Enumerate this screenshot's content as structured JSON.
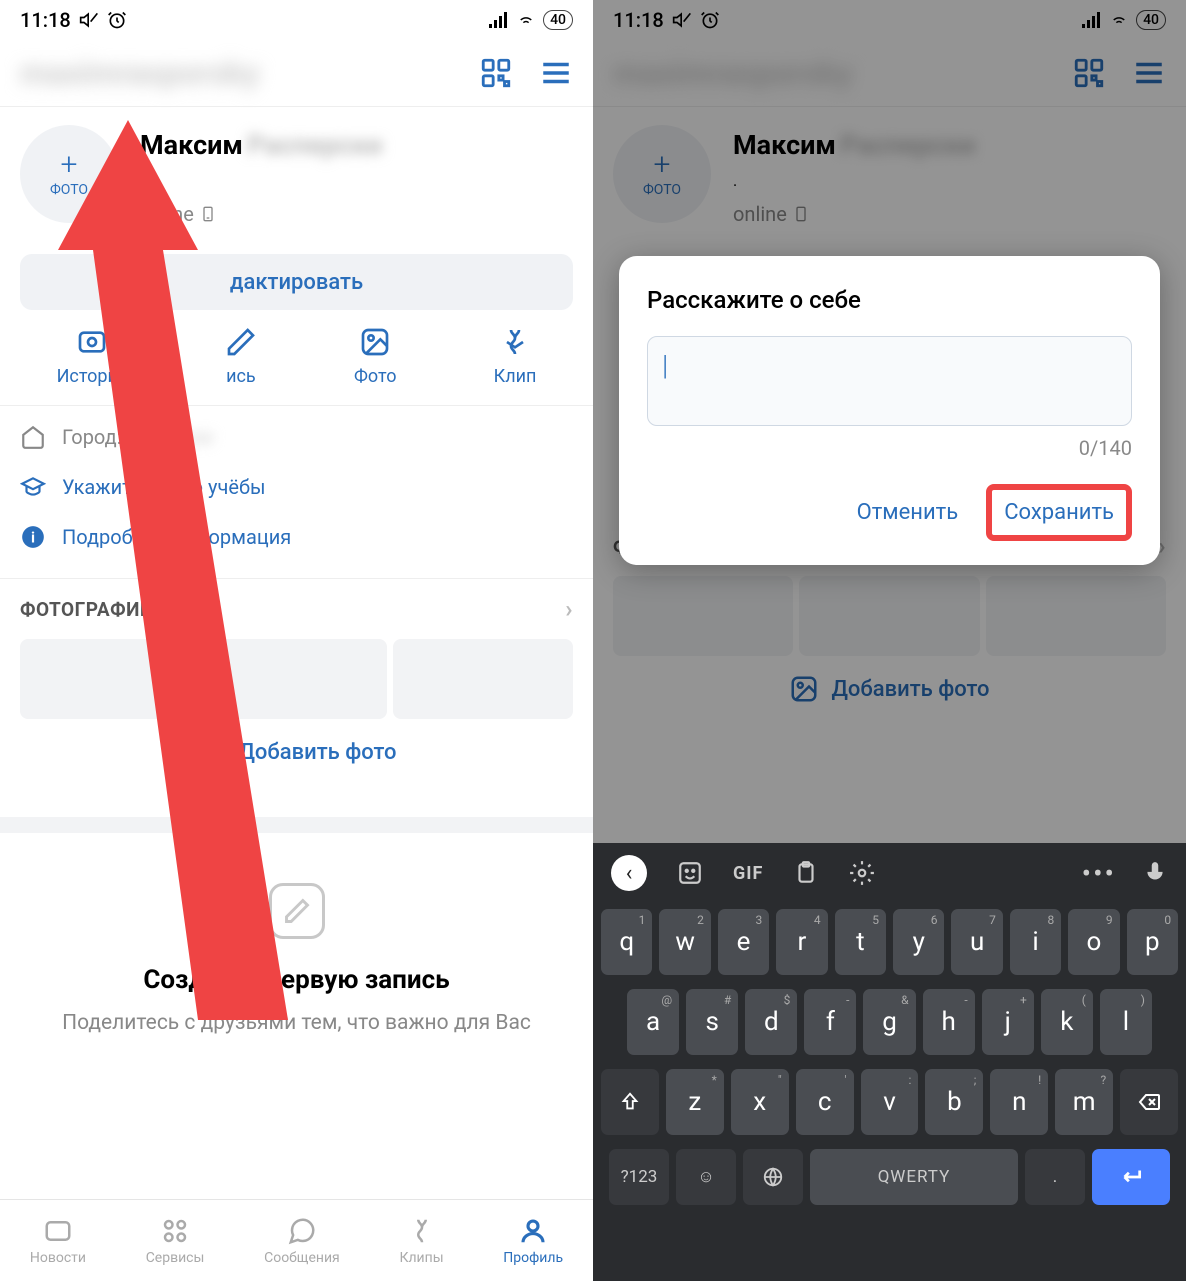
{
  "status": {
    "time": "11:18",
    "battery": "40"
  },
  "header": {
    "username_blur": "maximrasporsky"
  },
  "profile": {
    "photo_label": "ФОТО",
    "name_first": "Максим",
    "name_blur": "Расперски",
    "status_dot": ".",
    "online": "online"
  },
  "edit_button": "дактировать",
  "actions": {
    "story": "История",
    "post": "ись",
    "photo": "Фото",
    "clip": "Клип"
  },
  "info": {
    "city_label": "Город:",
    "study": "Укажите место учёбы",
    "details": "Подробная информация"
  },
  "photos_section": "ФОТОГРАФИИ",
  "add_photo": "Добавить фото",
  "add_photo_right": "Добавить фото",
  "create_post": {
    "title": "Создайте первую запись",
    "subtitle": "Поделитесь с друзьями тем, что важно для Вас"
  },
  "nav": {
    "news": "Новости",
    "services": "Сервисы",
    "messages": "Сообщения",
    "clips": "Клипы",
    "profile": "Профиль"
  },
  "dialog": {
    "title": "Расскажите о себе",
    "counter": "0/140",
    "cancel": "Отменить",
    "save": "Сохранить"
  },
  "keyboard": {
    "gif": "GIF",
    "row1": [
      "q",
      "w",
      "e",
      "r",
      "t",
      "y",
      "u",
      "i",
      "o",
      "p"
    ],
    "row1_sup": [
      "1",
      "2",
      "3",
      "4",
      "5",
      "6",
      "7",
      "8",
      "9",
      "0"
    ],
    "row2": [
      "a",
      "s",
      "d",
      "f",
      "g",
      "h",
      "j",
      "k",
      "l"
    ],
    "row2_sup": [
      "@",
      "#",
      "$",
      "-",
      "&",
      "-",
      "+",
      "(",
      ")"
    ],
    "row3": [
      "z",
      "x",
      "c",
      "v",
      "b",
      "n",
      "m"
    ],
    "row3_sup": [
      "*",
      "\"",
      "'",
      ":",
      ";",
      "!",
      "?"
    ],
    "sym": "?123",
    "space": "QWERTY"
  }
}
